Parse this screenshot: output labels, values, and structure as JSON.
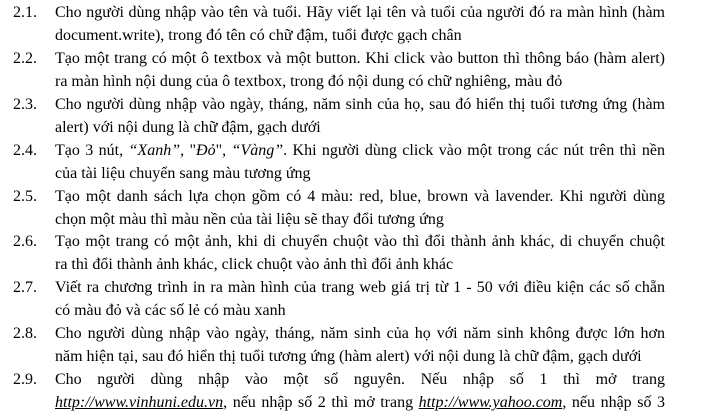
{
  "items": [
    {
      "number": "2.1.",
      "line1": "Cho người dùng nhập vào tên và tuổi. Hãy viết lại tên và tuổi của người đó ra màn hình (hàm",
      "line2": "document.write), trong đó tên có chữ đậm, tuổi được gạch chân"
    },
    {
      "number": "2.2.",
      "line1": "Tạo một trang có một ô textbox và một button. Khi click vào button thì thông báo (hàm alert)",
      "line2": "ra màn hình nội dung của ô textbox, trong đó nội dung có chữ nghiêng, màu đỏ"
    },
    {
      "number": "2.3.",
      "line1": "Cho người dùng nhập vào ngày, tháng, năm sinh của họ, sau đó hiển thị tuổi tương ứng (hàm",
      "line2": "alert) với nội dung là chữ đậm, gạch dưới"
    },
    {
      "number": "2.4.",
      "line1_a": "Tạo 3 nút, ",
      "line1_b": "“Xanh”",
      "line1_c": ", \"",
      "line1_d": "Đỏ",
      "line1_e": "\", ",
      "line1_f": "“Vàng”",
      "line1_g": ". Khi người dùng click vào một trong các nút trên thì nền",
      "line2": "của tài liệu chuyển sang màu tương ứng"
    },
    {
      "number": "2.5.",
      "line1": "Tạo một danh sách lựa chọn gồm có 4 màu: red, blue, brown và lavender. Khi người dùng",
      "line2": "chọn một màu thì màu nền của tài liệu sẽ thay đổi tương ứng"
    },
    {
      "number": "2.6.",
      "line1": "Tạo một trang có một ảnh, khi di chuyển chuột vào thì đổi thành ảnh khác, di chuyển chuột",
      "line2": "ra thì đổi thành ảnh khác, click chuột vào ảnh thì đổi ảnh khác"
    },
    {
      "number": "2.7.",
      "line1": "Viết ra chương trình in ra màn hình của trang web giá trị từ 1 - 50 với điều kiện các số chẵn",
      "line2": "có màu đỏ và các số lẻ có màu xanh"
    },
    {
      "number": "2.8.",
      "line1": "Cho người dùng nhập vào ngày, tháng, năm sinh của họ với năm sinh không được lớn hơn",
      "line2": "năm hiện tại, sau đó hiển thị tuổi tương ứng (hàm alert) với nội dung là chữ đậm, gạch dưới"
    },
    {
      "number": "2.9.",
      "line1": "Cho người dùng nhập vào một số nguyên. Nếu nhập số 1 thì mở trang",
      "link1": "http://www.vinhuni.edu.vn",
      "line2_mid": ", nếu nhập số 2 thì mở trang ",
      "link2": "http://www.yahoo.com",
      "line2_end": ", nếu nhập số 3"
    }
  ]
}
